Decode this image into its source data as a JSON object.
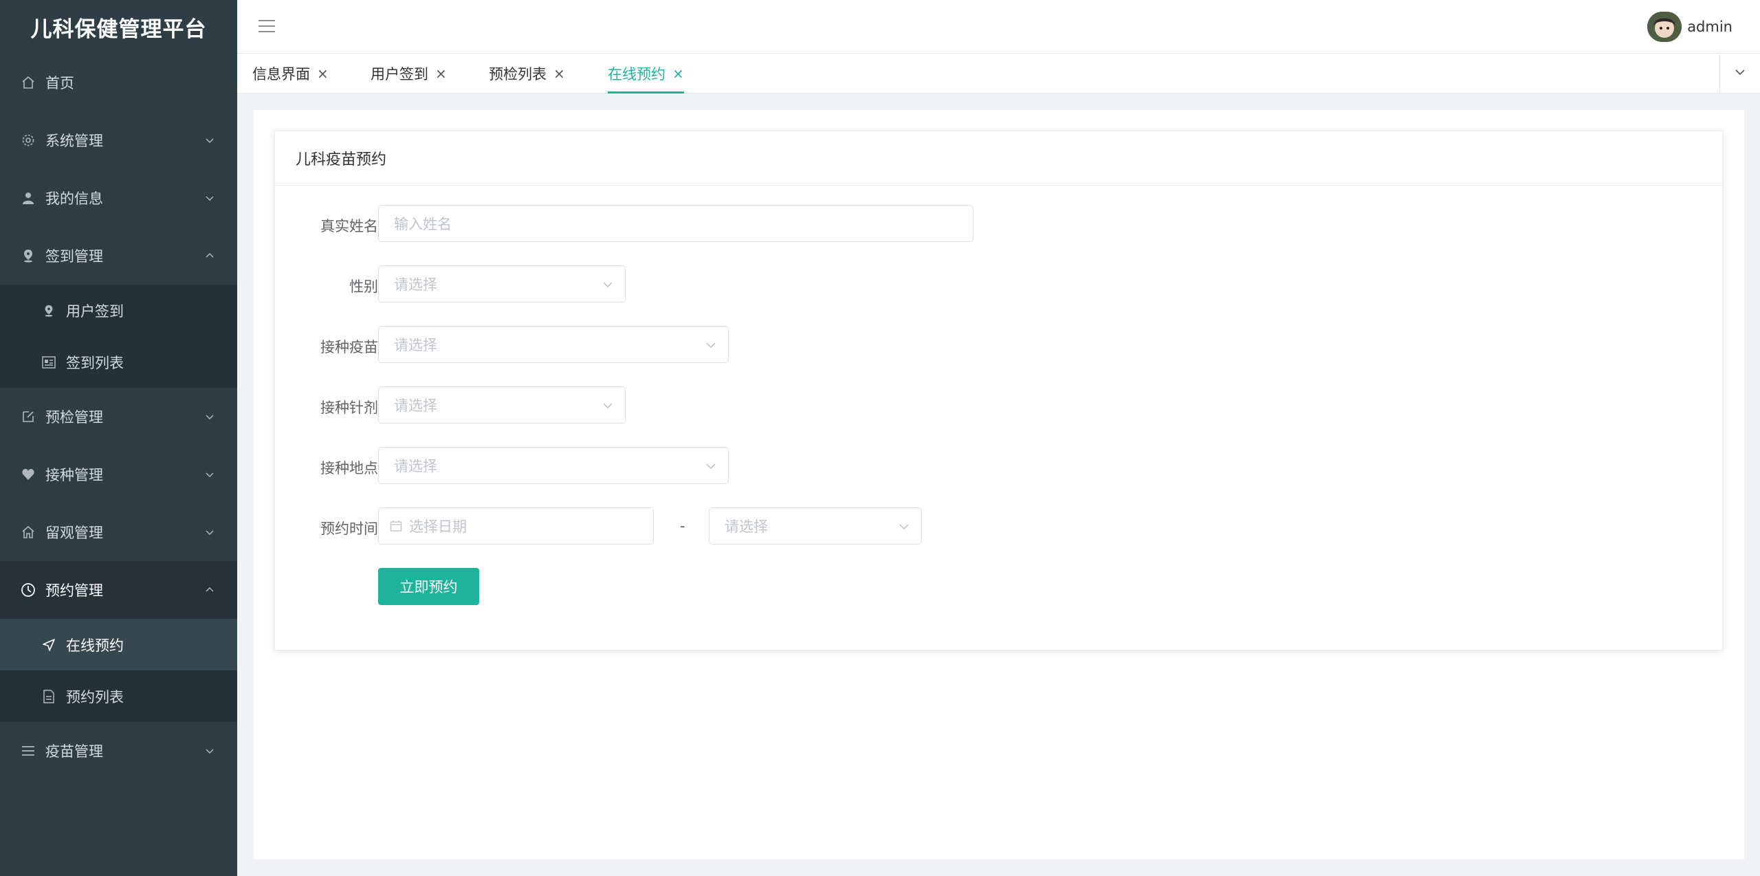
{
  "app": {
    "title": "儿科保健管理平台"
  },
  "sidebar": {
    "items": [
      {
        "label": "首页",
        "icon": "home-icon"
      },
      {
        "label": "系统管理",
        "icon": "gear-icon",
        "expandable": true
      },
      {
        "label": "我的信息",
        "icon": "user-icon",
        "expandable": true
      },
      {
        "label": "签到管理",
        "icon": "location-pin-icon",
        "expandable": true,
        "expanded": true,
        "children": [
          {
            "label": "用户签到",
            "icon": "location-pin-icon"
          },
          {
            "label": "签到列表",
            "icon": "list-card-icon"
          }
        ]
      },
      {
        "label": "预检管理",
        "icon": "edit-icon",
        "expandable": true
      },
      {
        "label": "接种管理",
        "icon": "heart-icon",
        "expandable": true
      },
      {
        "label": "留观管理",
        "icon": "house-icon",
        "expandable": true
      },
      {
        "label": "预约管理",
        "icon": "clock-icon",
        "expandable": true,
        "expanded": true,
        "active": true,
        "children": [
          {
            "label": "在线预约",
            "icon": "send-icon",
            "active": true
          },
          {
            "label": "预约列表",
            "icon": "document-icon"
          }
        ]
      },
      {
        "label": "疫苗管理",
        "icon": "menu-lines-icon",
        "expandable": true
      }
    ]
  },
  "header": {
    "user_name": "admin"
  },
  "tabs": [
    {
      "label": "信息界面",
      "close": "×"
    },
    {
      "label": "用户签到",
      "close": "×"
    },
    {
      "label": "预检列表",
      "close": "×"
    },
    {
      "label": "在线预约",
      "close": "×",
      "active": true
    }
  ],
  "form": {
    "title": "儿科疫苗预约",
    "fields": {
      "name": {
        "label": "真实姓名",
        "placeholder": "输入姓名"
      },
      "gender": {
        "label": "性别",
        "placeholder": "请选择"
      },
      "vaccine": {
        "label": "接种疫苗",
        "placeholder": "请选择"
      },
      "dose": {
        "label": "接种针剂",
        "placeholder": "请选择"
      },
      "location": {
        "label": "接种地点",
        "placeholder": "请选择"
      },
      "time": {
        "label": "预约时间",
        "date_placeholder": "选择日期",
        "separator": "-",
        "slot_placeholder": "请选择"
      }
    },
    "submit_label": "立即预约"
  },
  "colors": {
    "accent": "#1eb49c",
    "sidebar_bg": "#2f3d44",
    "sidebar_active": "#37474f"
  }
}
